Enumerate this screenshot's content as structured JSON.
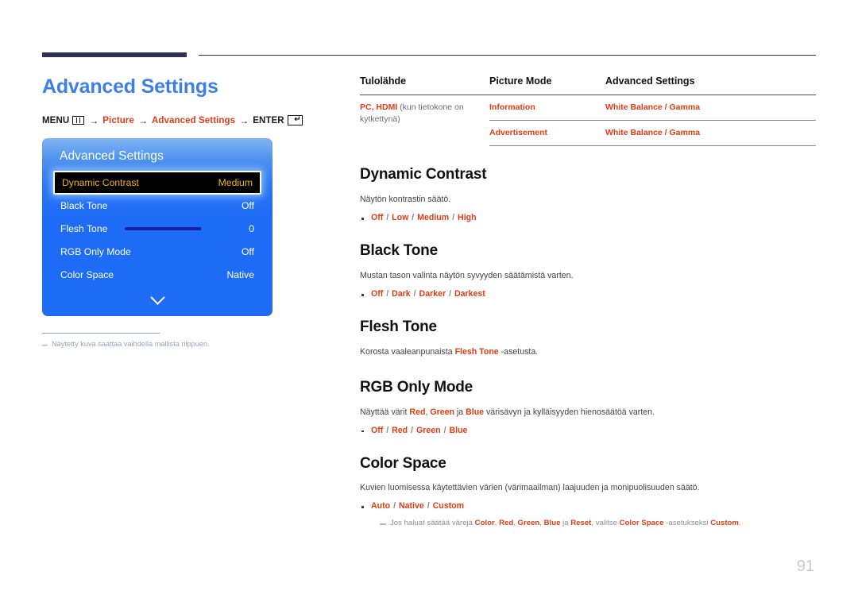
{
  "page": {
    "title": "Advanced Settings",
    "number": "91"
  },
  "breadcrumb": {
    "menu": "MENU",
    "menu_icon": "menu-grid-icon",
    "arrow": "→",
    "picture": "Picture",
    "advanced_settings": "Advanced Settings",
    "enter": "ENTER",
    "enter_icon": "enter-key-icon"
  },
  "osd": {
    "title": "Advanced Settings",
    "chevron_icon": "chevron-down-icon",
    "rows": [
      {
        "label": "Dynamic Contrast",
        "value": "Medium",
        "selected": true,
        "slider": false
      },
      {
        "label": "Black Tone",
        "value": "Off",
        "selected": false,
        "slider": false
      },
      {
        "label": "Flesh Tone",
        "value": "0",
        "selected": false,
        "slider": true
      },
      {
        "label": "RGB Only Mode",
        "value": "Off",
        "selected": false,
        "slider": false
      },
      {
        "label": "Color Space",
        "value": "Native",
        "selected": false,
        "slider": false
      }
    ]
  },
  "left_note": "Näytetty kuva saattaa vaihdella mallista riippuen.",
  "table": {
    "headers": [
      "Tulolähde",
      "Picture Mode",
      "Advanced Settings"
    ],
    "rows": [
      {
        "source_main": "PC, HDMI",
        "source_note": "(kun tietokone on kytkettynä)",
        "picture_mode": "Information",
        "advanced": "White Balance / Gamma"
      },
      {
        "source_main": "",
        "source_note": "",
        "picture_mode": "Advertisement",
        "advanced": "White Balance / Gamma"
      }
    ]
  },
  "sections": [
    {
      "heading": "Dynamic Contrast",
      "desc_pre": "Näytön kontrastin säätö.",
      "options": [
        "Off",
        "Low",
        "Medium",
        "High"
      ]
    },
    {
      "heading": "Black Tone",
      "desc_pre": "Mustan tason valinta näytön syvyyden säätämistä varten.",
      "options": [
        "Off",
        "Dark",
        "Darker",
        "Darkest"
      ]
    },
    {
      "heading": "Flesh Tone",
      "desc_pre": "Korosta vaaleanpunaista ",
      "desc_red": "Flesh Tone",
      "desc_post": " -asetusta.",
      "options": []
    },
    {
      "heading": "RGB Only Mode",
      "desc_pre": "Näyttää värit ",
      "desc_red": "Red",
      "desc_mid1": ", ",
      "desc_red2": "Green",
      "desc_mid2": " ja ",
      "desc_red3": "Blue",
      "desc_post": " värisävyn ja kylläisyyden hienosäätöä varten.",
      "options": [
        "Off",
        "Red",
        "Green",
        "Blue"
      ]
    },
    {
      "heading": "Color Space",
      "desc_pre": "Kuvien luomisessa käytettävien värien (värimaailman) laajuuden ja monipuolisuuden säätö.",
      "options": [
        "Auto",
        "Native",
        "Custom"
      ],
      "subnote": {
        "t1": "Jos haluat säätää värejä ",
        "r1": "Color",
        "t2": ", ",
        "r2": "Red",
        "t3": ", ",
        "r3": "Green",
        "t4": ", ",
        "r4": "Blue",
        "t5": " ja ",
        "r5": "Reset",
        "t6": ", valitse ",
        "r6": "Color Space",
        "t7": " -asetukseksi ",
        "r7": "Custom",
        "t8": "."
      }
    }
  ],
  "colors": {
    "title_blue": "#3d7fe8",
    "accent_red": "#e03c14",
    "osd_blue": "#1f6df6",
    "rule_navy": "#2e3154",
    "selected_gold": "#f0b414"
  }
}
